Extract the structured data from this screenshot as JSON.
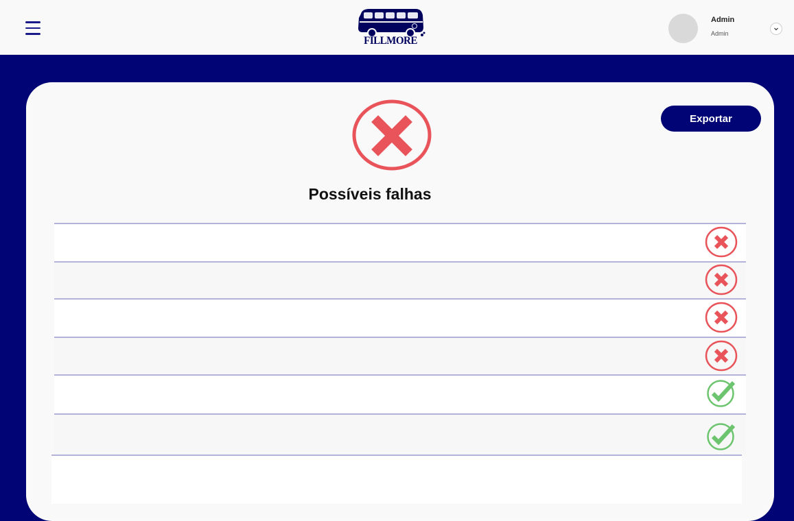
{
  "header": {
    "menu_icon": "hamburger-menu-icon",
    "logo_text": "FILLMORE",
    "user": {
      "name": "Admin",
      "role": "Admin"
    }
  },
  "main": {
    "export_label": "Exportar",
    "title": "Possíveis falhas",
    "status_icon": "error-x-icon",
    "rows": [
      {
        "text": "",
        "status": "fail"
      },
      {
        "text": "",
        "status": "fail"
      },
      {
        "text": "",
        "status": "fail"
      },
      {
        "text": "",
        "status": "fail"
      },
      {
        "text": "",
        "status": "ok"
      },
      {
        "text": "",
        "status": "ok"
      }
    ]
  },
  "colors": {
    "brand": "#010474",
    "fail": "#e8545a",
    "ok": "#6cc56e",
    "divider": "#b3b3d9"
  }
}
